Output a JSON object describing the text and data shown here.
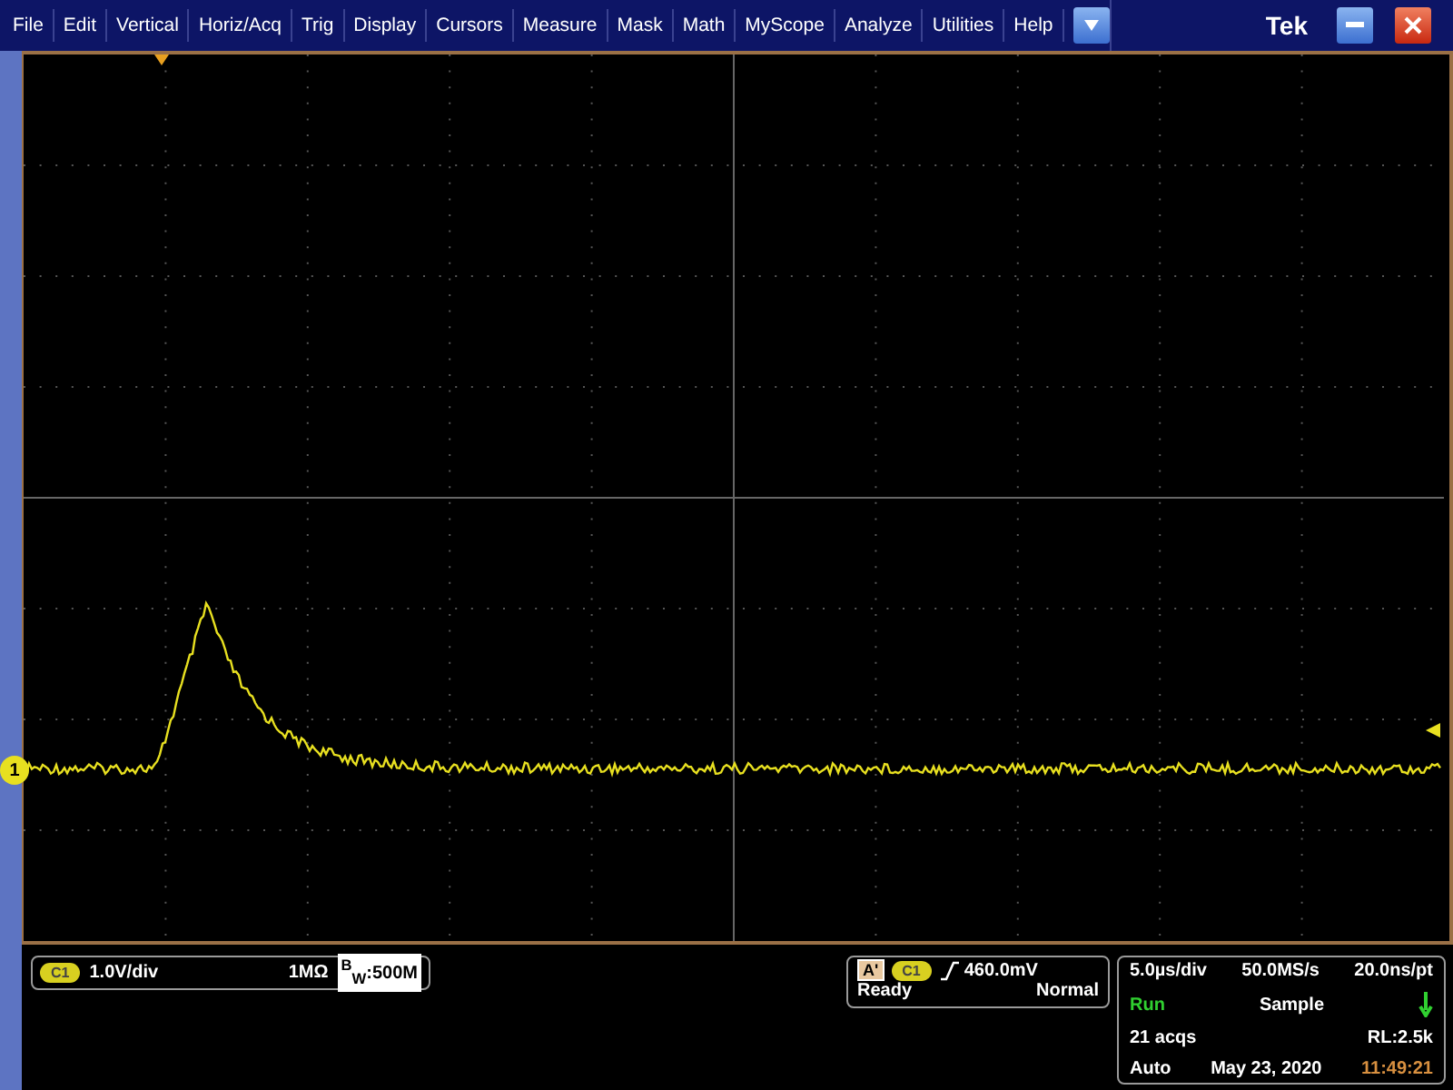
{
  "menu": [
    {
      "label": "File"
    },
    {
      "label": "Edit"
    },
    {
      "label": "Vertical"
    },
    {
      "label": "Horiz/Acq"
    },
    {
      "label": "Trig"
    },
    {
      "label": "Display"
    },
    {
      "label": "Cursors"
    },
    {
      "label": "Measure"
    },
    {
      "label": "Mask"
    },
    {
      "label": "Math"
    },
    {
      "label": "MyScope"
    },
    {
      "label": "Analyze"
    },
    {
      "label": "Utilities"
    },
    {
      "label": "Help"
    }
  ],
  "brand": "Tek",
  "channel_marker": "1",
  "channel_readout": {
    "badge": "C1",
    "scale": "1.0V/div",
    "termination": "1MΩ",
    "bandwidth": "$^{B}$$_{W}$:500M"
  },
  "trigger_readout": {
    "source": "A'",
    "badge": "C1",
    "level": "460.0mV",
    "state": "Ready",
    "mode": "Normal"
  },
  "timebase_readout": {
    "scale": "5.0µs/div",
    "sample_rate": "50.0MS/s",
    "resolution": "20.0ns/pt",
    "run_state": "Run",
    "acq_mode": "Sample",
    "acquisitions": "21 acqs",
    "record_length": "RL:2.5k",
    "trigger_mode": "Auto",
    "date": "May 23, 2020",
    "time": "11:49:21"
  }
}
